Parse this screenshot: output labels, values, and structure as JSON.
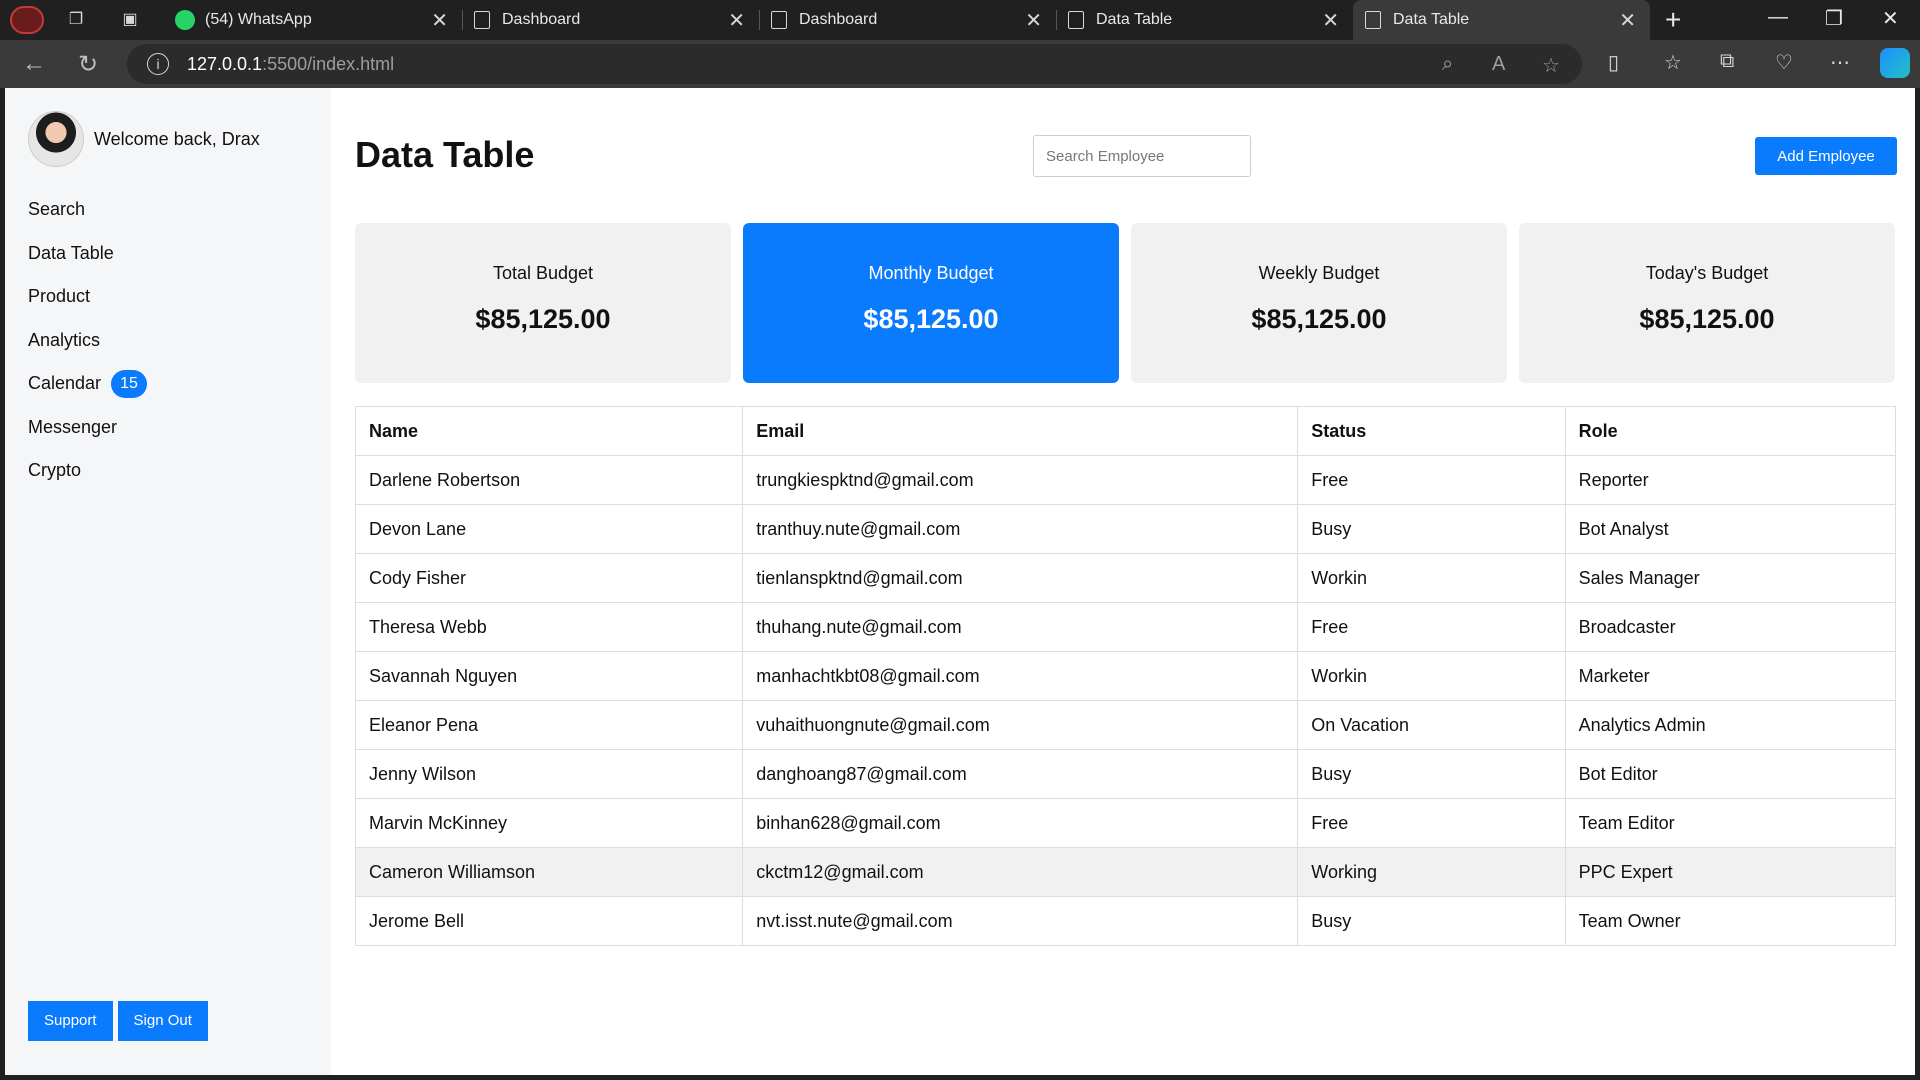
{
  "browser": {
    "tabs": [
      {
        "label": "(54) WhatsApp",
        "icon": "whatsapp-icon"
      },
      {
        "label": "Dashboard",
        "icon": "page-icon"
      },
      {
        "label": "Dashboard",
        "icon": "page-icon"
      },
      {
        "label": "Data Table",
        "icon": "page-icon"
      },
      {
        "label": "Data Table",
        "icon": "page-icon",
        "active": true
      }
    ],
    "url_host": "127.0.0.1",
    "url_path": ":5500/index.html"
  },
  "sidebar": {
    "welcome": "Welcome back, Drax",
    "items": [
      {
        "label": "Search"
      },
      {
        "label": "Data Table"
      },
      {
        "label": "Product"
      },
      {
        "label": "Analytics"
      },
      {
        "label": "Calendar",
        "badge": "15"
      },
      {
        "label": "Messenger"
      },
      {
        "label": "Crypto"
      }
    ],
    "support_label": "Support",
    "signout_label": "Sign Out"
  },
  "header": {
    "title": "Data Table",
    "search_placeholder": "Search Employee",
    "add_label": "Add Employee"
  },
  "cards": [
    {
      "label": "Total Budget",
      "value": "$85,125.00"
    },
    {
      "label": "Monthly Budget",
      "value": "$85,125.00"
    },
    {
      "label": "Weekly Budget",
      "value": "$85,125.00"
    },
    {
      "label": "Today's Budget",
      "value": "$85,125.00"
    }
  ],
  "table": {
    "columns": [
      "Name",
      "Email",
      "Status",
      "Role"
    ],
    "rows": [
      [
        "Darlene Robertson",
        "trungkiespktnd@gmail.com",
        "Free",
        "Reporter"
      ],
      [
        "Devon Lane",
        "tranthuy.nute@gmail.com",
        "Busy",
        "Bot Analyst"
      ],
      [
        "Cody Fisher",
        "tienlanspktnd@gmail.com",
        "Workin",
        "Sales Manager"
      ],
      [
        "Theresa Webb",
        "thuhang.nute@gmail.com",
        "Free",
        "Broadcaster"
      ],
      [
        "Savannah Nguyen",
        "manhachtkbt08@gmail.com",
        "Workin",
        "Marketer"
      ],
      [
        "Eleanor Pena",
        "vuhaithuongnute@gmail.com",
        "On Vacation",
        "Analytics Admin"
      ],
      [
        "Jenny Wilson",
        "danghoang87@gmail.com",
        "Busy",
        "Bot Editor"
      ],
      [
        "Marvin McKinney",
        "binhan628@gmail.com",
        "Free",
        "Team Editor"
      ],
      [
        "Cameron Williamson",
        "ckctm12@gmail.com",
        "Working",
        "PPC Expert"
      ],
      [
        "Jerome Bell",
        "nvt.isst.nute@gmail.com",
        "Busy",
        "Team Owner"
      ]
    ]
  },
  "colors": {
    "accent": "#0b7bfe",
    "card_bg": "#f1f1f1",
    "sidebar_bg": "#f5f6f8"
  }
}
